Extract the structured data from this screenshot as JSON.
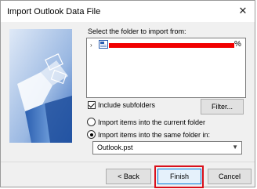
{
  "window": {
    "title": "Import Outlook Data File",
    "close_glyph": "✕"
  },
  "folder_prompt": "Select the folder to import from:",
  "tree": {
    "expander": "›",
    "trailing_text": "%"
  },
  "include_subfolders": {
    "label": "Include subfolders",
    "checked": true
  },
  "filter_button": "Filter...",
  "options": [
    {
      "label": "Import items into the current folder",
      "selected": false
    },
    {
      "label": "Import items into the same folder in:",
      "selected": true
    }
  ],
  "target_folder": {
    "value": "Outlook.pst"
  },
  "buttons": {
    "back": "< Back",
    "finish": "Finish",
    "cancel": "Cancel"
  },
  "colors": {
    "highlight": "#d9101b",
    "redaction": "#f10000"
  }
}
